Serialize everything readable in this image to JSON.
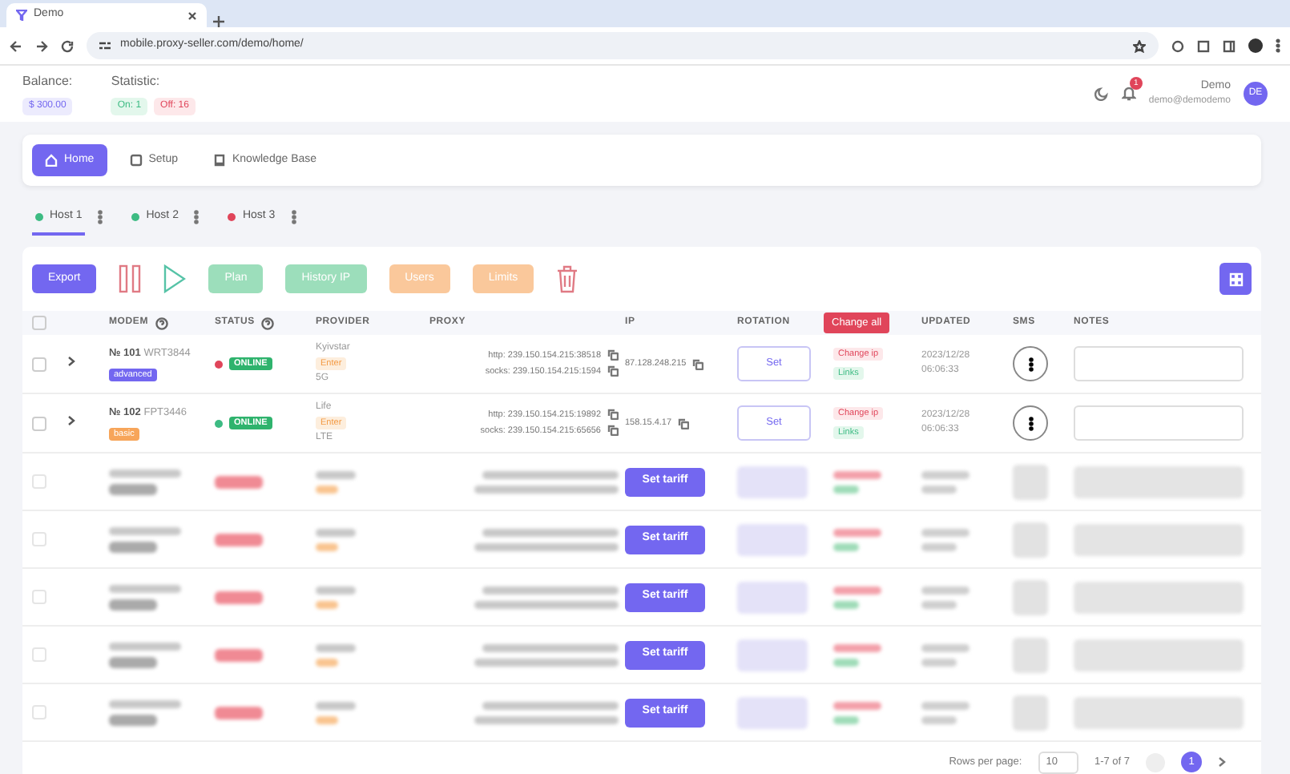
{
  "browser": {
    "tab_title": "Demo",
    "url": "mobile.proxy-seller.com/demo/home/"
  },
  "header": {
    "balance_label": "Balance:",
    "balance": "$ 300.00",
    "statistic_label": "Statistic:",
    "on": "On: 1",
    "off": "Off: 16",
    "notifications": "1",
    "user_name": "Demo",
    "user_email": "demo@demodemo",
    "avatar": "DE"
  },
  "nav": [
    {
      "label": "Home",
      "kind": "home",
      "selected": true
    },
    {
      "label": "Setup",
      "kind": "setup",
      "selected": false
    },
    {
      "label": "Knowledge Base",
      "kind": "book",
      "selected": false
    }
  ],
  "hosts": [
    {
      "label": "Host 1",
      "color": "#3dbb83",
      "selected": true
    },
    {
      "label": "Host 2",
      "color": "#3dbb83",
      "selected": false
    },
    {
      "label": "Host 3",
      "color": "#e0455a",
      "selected": false
    }
  ],
  "toolbar": {
    "export": "Export",
    "buttons": [
      {
        "label": "Plan",
        "kind": "success",
        "disabled": true
      },
      {
        "label": "History IP",
        "kind": "success",
        "disabled": true
      },
      {
        "label": "Users",
        "kind": "warning",
        "disabled": true
      },
      {
        "label": "Limits",
        "kind": "warning",
        "disabled": true
      }
    ]
  },
  "select_all": {
    "checked": false
  },
  "columns": [
    {
      "label": "MODEM",
      "help": true
    },
    {
      "label": "STATUS",
      "help": true
    },
    {
      "label": "PROVIDER"
    },
    {
      "label": "PROXY"
    },
    {
      "label": "IP"
    },
    {
      "label": "ROTATION"
    },
    {
      "label": "UPDATED"
    },
    {
      "label": "SMS"
    },
    {
      "label": "NOTES"
    }
  ],
  "change_all": "Change all",
  "rows": [
    {
      "checked": false,
      "number": "№ 101",
      "serial": "WRT3844",
      "plan": {
        "label": "advanced",
        "color": "#7367f0"
      },
      "status_dot": {
        "color": "#e0455a"
      },
      "status": "ONLINE",
      "provider": "Kyivstar",
      "provider_tag": "Enter",
      "network": "5G",
      "http": "http: 239.150.154.215:38518",
      "socks": "socks: 239.150.154.215:1594",
      "ip": "87.128.248.215",
      "rotation": "Set",
      "change_ip": "Change ip",
      "links": "Links",
      "updated_date": "2023/12/28",
      "updated_time": "06:06:33"
    },
    {
      "checked": false,
      "number": "№ 102",
      "serial": "FPT3446",
      "plan": {
        "label": "basic",
        "color": "#f7a55a"
      },
      "status_dot": {
        "color": "#3dbb83"
      },
      "status": "ONLINE",
      "provider": "Life",
      "provider_tag": "Enter",
      "network": "LTE",
      "http": "http: 239.150.154.215:19892",
      "socks": "socks: 239.150.154.215:65656",
      "ip": "158.15.4.17",
      "rotation": "Set",
      "change_ip": "Change ip",
      "links": "Links",
      "updated_date": "2023/12/28",
      "updated_time": "06:06:33"
    }
  ],
  "blurred_rows": [
    {
      "checked": false,
      "action": "Set tariff"
    },
    {
      "checked": false,
      "action": "Set tariff"
    },
    {
      "checked": false,
      "action": "Set tariff"
    },
    {
      "checked": false,
      "action": "Set tariff"
    },
    {
      "checked": false,
      "action": "Set tariff"
    }
  ],
  "footer": {
    "rows_per_page_label": "Rows per page:",
    "rows_per_page": "10",
    "range": "1-7 of 7",
    "page": "1"
  }
}
